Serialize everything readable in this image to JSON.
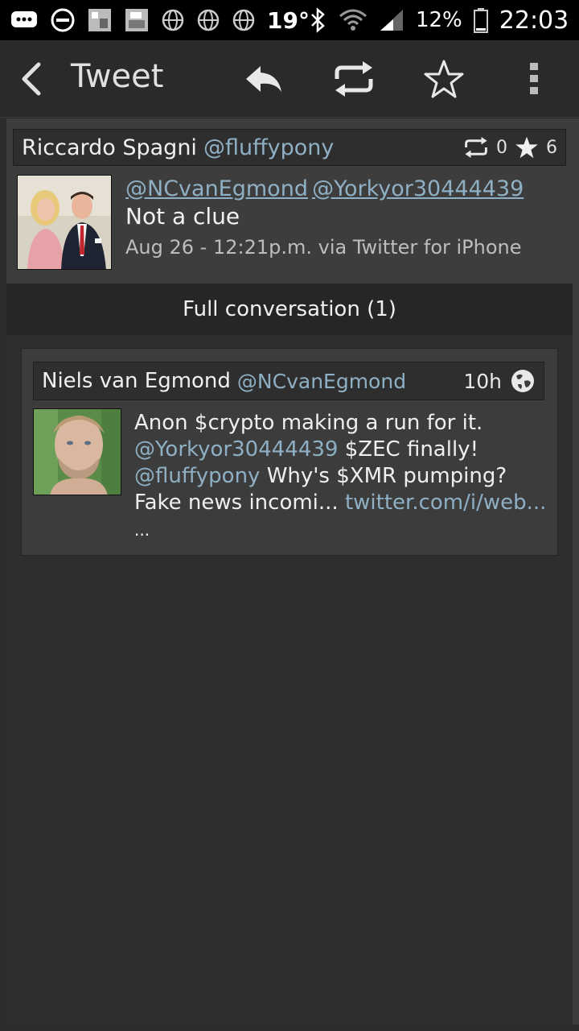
{
  "status_bar": {
    "temperature": "19°",
    "battery": "12%",
    "time": "22:03"
  },
  "action_bar": {
    "title": "Tweet",
    "icons": [
      "back-icon",
      "reply-icon",
      "retweet-icon",
      "star-icon",
      "overflow-menu-icon"
    ]
  },
  "tweet": {
    "author_name": "Riccardo Spagni",
    "author_handle": "@fluffypony",
    "retweet_count": "0",
    "favorite_count": "6",
    "mention_1": "@NCvanEgmond",
    "mention_2": "@Yorkyor30444439",
    "text": "Not a clue",
    "meta": "Aug 26 - 12:21p.m. via Twitter for iPhone"
  },
  "conversation": {
    "label": "Full conversation (1)",
    "reply": {
      "author_name": "Niels van Egmond",
      "author_handle": "@NCvanEgmond",
      "time": "10h",
      "text_1": "Anon $crypto making a run for it.",
      "mention_1": "@Yorkyor30444439",
      "text_2": " $ZEC finally!",
      "mention_2": "@fluffypony",
      "text_3": " Why's $XMR pumping?",
      "text_4": "Fake news incomi... ",
      "link": "twitter.com/i/web...",
      "ellipsis": "..."
    }
  },
  "colors": {
    "background": "#2d2d2d",
    "panel": "#3d3d3d",
    "link": "#8fb0c4"
  }
}
